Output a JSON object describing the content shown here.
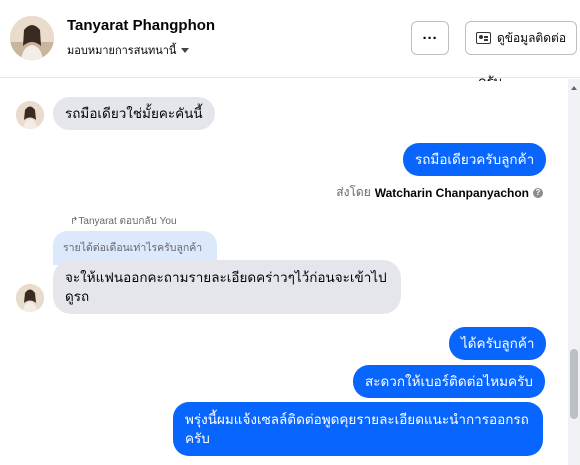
{
  "header": {
    "name": "Tanyarat Phangphon",
    "assign_label": "มอบหมายการสนทนานี้",
    "more_label": "···",
    "contact_button": "ดูข้อมูลติดต่อ"
  },
  "messages": {
    "cut_text": "ครับ",
    "m1": "รถมือเดียวใช่มั้ยคะคันนี้",
    "m2": "รถมือเดียวครับลูกค้า",
    "sent_by_prefix": "ส่งโดย",
    "sent_by_name": "Watcharin Chanpanyachon",
    "reply_label": "Tanyarat ตอบกลับ You",
    "quoted": "รายได้ต่อเดือนเท่าไรครับลูกค้า",
    "m3": "จะให้แฟนออกคะถามรายละเอียดคร่าวๆไว้ก่อนจะเข้าไปดูรถ",
    "m4": "ได้ครับลูกค้า",
    "m5": "สะดวกให้เบอร์ติดต่อไหมครับ",
    "m6": "พรุ่งนี้ผมแจ้งเซลล์ติดต่อพูดคุยรายละเอียดแนะนำการออกรถครับ"
  },
  "colors": {
    "outgoing_bubble": "#0866ff",
    "incoming_bubble": "#e4e6eb",
    "quoted_bubble": "#dce8fb"
  }
}
